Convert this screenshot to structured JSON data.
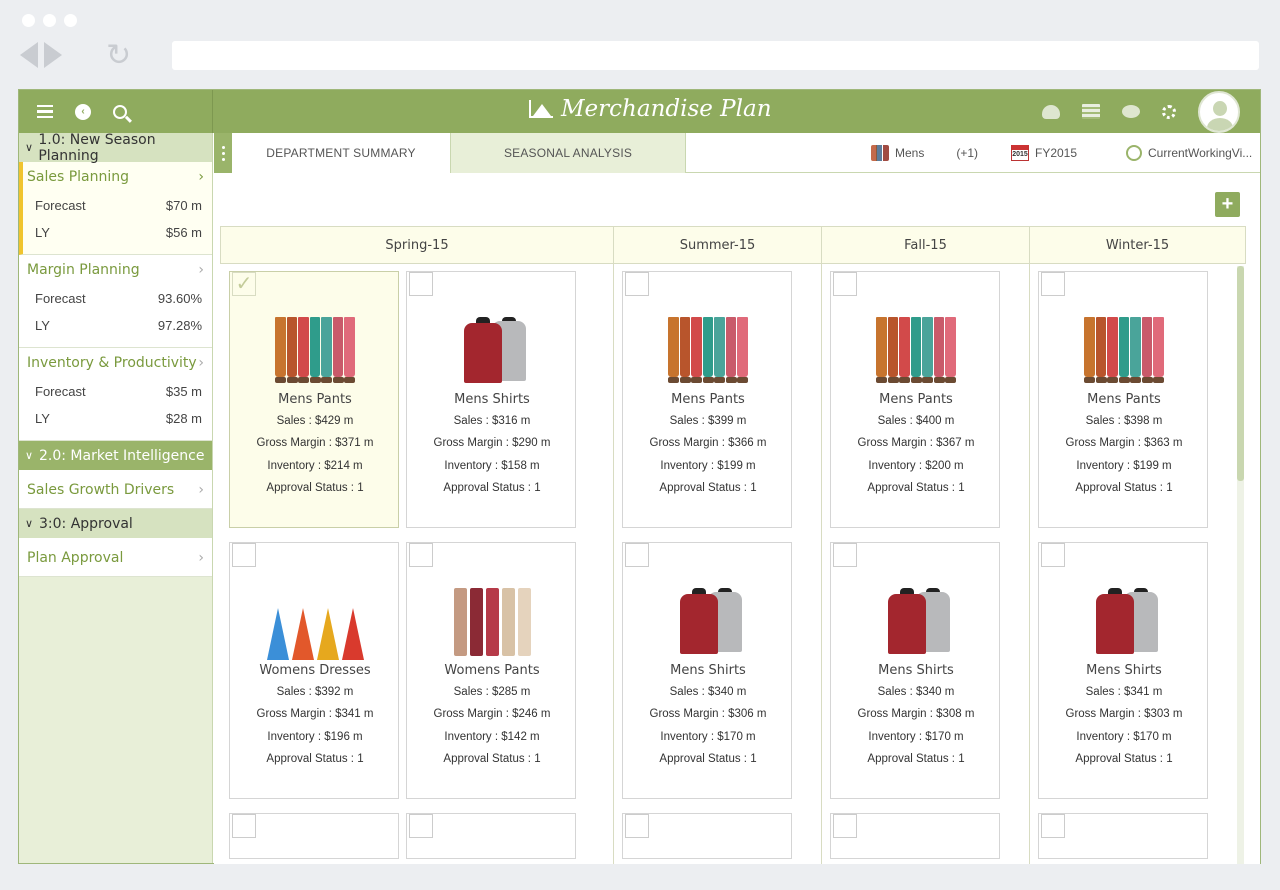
{
  "app": {
    "title": "Merchandise Plan",
    "colors": {
      "brand": "#8fab5e",
      "accent_selected": "#f0c42e",
      "panel": "#e8efd8"
    }
  },
  "icons": {
    "sidebar_toolbar": [
      "menu-icon",
      "back-icon",
      "search-icon"
    ],
    "topbar_right": [
      "cloud-download-icon",
      "server-icon",
      "chat-icon",
      "settings-icon",
      "user-avatar"
    ]
  },
  "sidebar": {
    "sections": [
      {
        "label": "1.0: New Season Planning",
        "items": [
          {
            "label": "Sales Planning",
            "rows": [
              {
                "k": "Forecast",
                "v": "$70 m"
              },
              {
                "k": "LY",
                "v": "$56 m"
              }
            ]
          },
          {
            "label": "Margin Planning",
            "rows": [
              {
                "k": "Forecast",
                "v": "93.60%"
              },
              {
                "k": "LY",
                "v": "97.28%"
              }
            ]
          },
          {
            "label": "Inventory & Productivity",
            "rows": [
              {
                "k": "Forecast",
                "v": "$35 m"
              },
              {
                "k": "LY",
                "v": "$28 m"
              }
            ]
          }
        ]
      },
      {
        "label": "2.0: Market Intelligence",
        "items": [
          {
            "label": "Sales Growth Drivers"
          }
        ]
      },
      {
        "label": "3:0: Approval",
        "items": [
          {
            "label": "Plan Approval"
          }
        ]
      }
    ]
  },
  "tabs": [
    {
      "label": "DEPARTMENT SUMMARY"
    },
    {
      "label": "SEASONAL ANALYSIS"
    }
  ],
  "filters": {
    "department": "Mens",
    "extra": "(+1)",
    "calendar_badge": "2015",
    "year": "FY2015",
    "view": "CurrentWorkingVi..."
  },
  "add_button": "+",
  "seasons": [
    "Spring-15",
    "Summer-15",
    "Fall-15",
    "Winter-15"
  ],
  "labels": {
    "sales": "Sales : ",
    "gross_margin": "Gross Margin : ",
    "inventory": "Inventory : ",
    "approval_status": "Approval Status : "
  },
  "cards": [
    {
      "name": "Mens Pants",
      "img": "pants-icon",
      "sales": "$429 m",
      "gm": "$371 m",
      "inv": "$214 m",
      "status": "1"
    },
    {
      "name": "Mens Shirts",
      "img": "shirts-icon",
      "sales": "$316 m",
      "gm": "$290 m",
      "inv": "$158 m",
      "status": "1"
    },
    {
      "name": "Mens Pants",
      "img": "pants-icon",
      "sales": "$399 m",
      "gm": "$366 m",
      "inv": "$199 m",
      "status": "1"
    },
    {
      "name": "Mens Pants",
      "img": "pants-icon",
      "sales": "$400 m",
      "gm": "$367 m",
      "inv": "$200 m",
      "status": "1"
    },
    {
      "name": "Mens Pants",
      "img": "pants-icon",
      "sales": "$398 m",
      "gm": "$363 m",
      "inv": "$199 m",
      "status": "1"
    },
    {
      "name": "Womens Dresses",
      "img": "dresses-icon",
      "sales": "$392 m",
      "gm": "$341 m",
      "inv": "$196 m",
      "status": "1"
    },
    {
      "name": "Womens Pants",
      "img": "womens-pants-icon",
      "sales": "$285 m",
      "gm": "$246 m",
      "inv": "$142 m",
      "status": "1"
    },
    {
      "name": "Mens Shirts",
      "img": "shirts-icon",
      "sales": "$340 m",
      "gm": "$306 m",
      "inv": "$170 m",
      "status": "1"
    },
    {
      "name": "Mens Shirts",
      "img": "shirts-icon",
      "sales": "$340 m",
      "gm": "$308 m",
      "inv": "$170 m",
      "status": "1"
    },
    {
      "name": "Mens Shirts",
      "img": "shirts-icon",
      "sales": "$341 m",
      "gm": "$303 m",
      "inv": "$170 m",
      "status": "1"
    }
  ]
}
